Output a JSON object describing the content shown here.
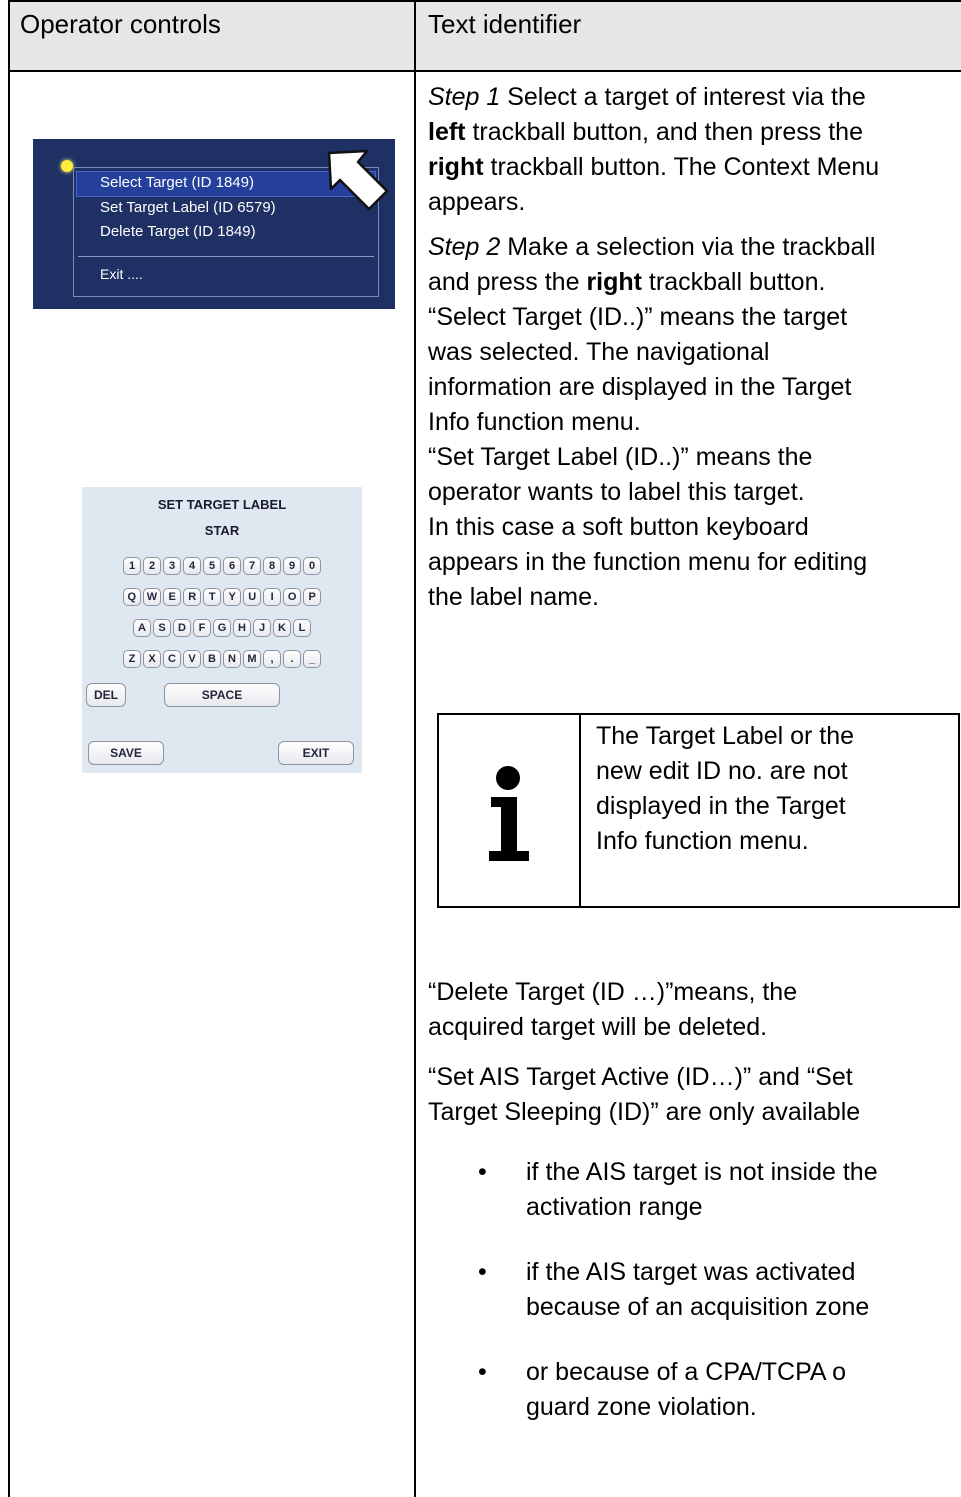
{
  "header": {
    "col1": "Operator controls",
    "col2": "Text identifier"
  },
  "context_menu": {
    "items": [
      "Select Target (ID 1849)",
      "Set Target Label (ID 6579)",
      "Delete Target (ID 1849)",
      "Exit ...."
    ]
  },
  "keyboard": {
    "title": "SET TARGET LABEL",
    "value": "STAR",
    "rows": [
      [
        "1",
        "2",
        "3",
        "4",
        "5",
        "6",
        "7",
        "8",
        "9",
        "0"
      ],
      [
        "Q",
        "W",
        "E",
        "R",
        "T",
        "Y",
        "U",
        "I",
        "O",
        "P"
      ],
      [
        "A",
        "S",
        "D",
        "F",
        "G",
        "H",
        "J",
        "K",
        "L"
      ],
      [
        "Z",
        "X",
        "C",
        "V",
        "B",
        "N",
        "M",
        ",",
        ".",
        "_"
      ]
    ],
    "del_label": "DEL",
    "space_label": "SPACE",
    "save_label": "SAVE",
    "exit_label": "EXIT"
  },
  "step1": {
    "label": "Step 1",
    "line1_rest": " Select a target of interest via the",
    "line2_bold": "left",
    "line2_rest": " trackball button, and then press the",
    "line3_bold": "right",
    "line3_rest": " trackball button. The Context Menu",
    "line4": "appears."
  },
  "step2": {
    "label": "Step 2",
    "line1_rest": " Make a selection via the trackball",
    "line2_pre": "and press the ",
    "line2_bold": "right",
    "line2_rest": " trackball button.",
    "lines": [
      "“Select Target (ID..)” means the target",
      "was selected. The navigational",
      "information are displayed in the Target",
      "Info function menu.",
      "“Set Target Label (ID..)” means the",
      "operator wants to label this target.",
      "In this case a soft button keyboard",
      "appears in the function menu for editing",
      "the label name."
    ]
  },
  "note": {
    "icon": "info-icon",
    "lines": [
      "The Target Label or the",
      "new edit ID no. are not",
      "displayed in the Target",
      "Info function menu."
    ]
  },
  "delete_text": [
    "“Delete Target (ID …)”means, the",
    "acquired target will be deleted."
  ],
  "ais_text": [
    "“Set AIS Target Active (ID…)” and “Set",
    "Target Sleeping (ID)” are only available"
  ],
  "bullets": [
    [
      "if the AIS target is not inside the",
      "activation range"
    ],
    [
      "if the AIS target was activated",
      "because of an acquisition zone"
    ],
    [
      "or because of a CPA/TCPA o",
      "guard zone violation."
    ]
  ]
}
